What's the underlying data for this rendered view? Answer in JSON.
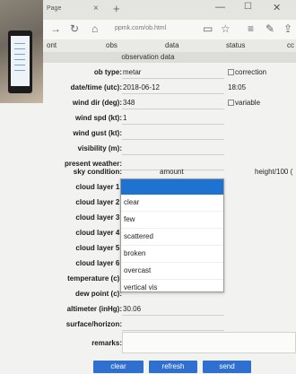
{
  "browser": {
    "tab_title": "Page",
    "url": "ppmk.com/ob.html",
    "tab_close": "×",
    "new_tab": "+"
  },
  "nav_tabs": [
    "ont",
    "obs",
    "data",
    "status",
    "cc"
  ],
  "section_title": "observation data",
  "fields": {
    "ob_type": {
      "label": "ob type:",
      "value": "metar",
      "option": "correction"
    },
    "datetime": {
      "label": "date/time (utc):",
      "value": "2018-06-12",
      "time": "18:05"
    },
    "wind_dir": {
      "label": "wind dir (deg):",
      "value": "348",
      "option": "variable"
    },
    "wind_spd": {
      "label": "wind spd (kt):",
      "value": "1"
    },
    "wind_gust": {
      "label": "wind gust (kt):",
      "value": ""
    },
    "visibility": {
      "label": "visibility (m):",
      "value": ""
    },
    "present_weather": {
      "label": "present weather:",
      "value": ""
    },
    "sky_condition": {
      "label": "sky condition:",
      "col_amount": "amount",
      "col_height": "height/100 ("
    },
    "cloud_layer_1": {
      "label": "cloud layer 1:"
    },
    "cloud_layer_2": {
      "label": "cloud layer 2:"
    },
    "cloud_layer_3": {
      "label": "cloud layer 3:"
    },
    "cloud_layer_4": {
      "label": "cloud layer 4:"
    },
    "cloud_layer_5": {
      "label": "cloud layer 5:"
    },
    "cloud_layer_6": {
      "label": "cloud layer 6:"
    },
    "temperature": {
      "label": "temperature (c):",
      "value": ""
    },
    "dew_point": {
      "label": "dew point (c):",
      "value": ""
    },
    "altimeter": {
      "label": "altimeter (inHg):",
      "value": "30.06"
    },
    "surface_horizon": {
      "label": "surface/horizon:",
      "value": ""
    },
    "remarks": {
      "label": "remarks:",
      "value": ""
    }
  },
  "cloud_amount_options": [
    "clear",
    "few",
    "scattered",
    "broken",
    "overcast",
    "vertical vis"
  ],
  "buttons": {
    "clear": "clear",
    "refresh": "refresh",
    "send": "send"
  }
}
